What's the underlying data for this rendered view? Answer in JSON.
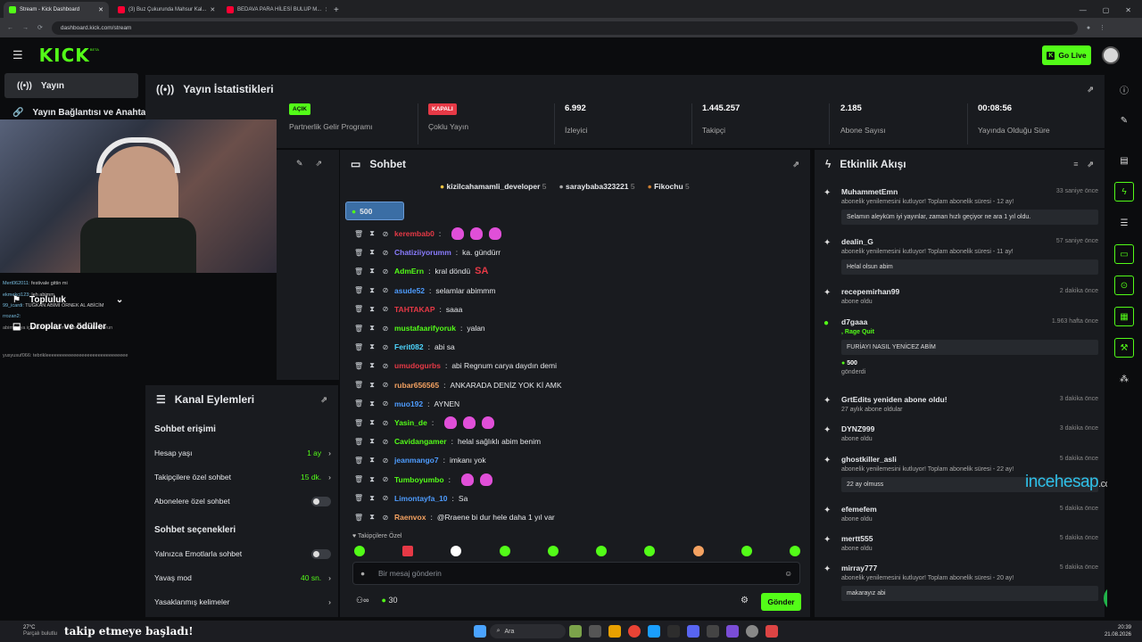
{
  "browser": {
    "tabs": [
      "Stream - Kick Dashboard",
      "(3) Buz Çukurunda Mahsur Kal...",
      "BEDAVA PARA HİLESİ BULUP M..."
    ],
    "new_tab": "+",
    "url": "dashboard.kick.com/stream"
  },
  "header": {
    "logo": "KICK",
    "logo_beta": "BETA",
    "go_live": "Go Live"
  },
  "nav": {
    "items": [
      "Yayın",
      "Yayın Bağlantısı ve Anahtarı",
      "Topluluk",
      "Droplar ve ödüller"
    ]
  },
  "stats": {
    "title": "Yayın İstatistikleri",
    "cells": [
      {
        "badge": "AÇIK",
        "badge_color": "#53fc18",
        "label": "Partnerlik Gelir Programı"
      },
      {
        "badge": "KAPALI",
        "badge_color": "#e63946",
        "label": "Çoklu Yayın"
      },
      {
        "value": "6.992",
        "label": "İzleyici"
      },
      {
        "value": "1.445.257",
        "label": "Takipçi"
      },
      {
        "value": "2.185",
        "label": "Abone Sayısı"
      },
      {
        "value": "00:08:56",
        "label": "Yayında Olduğu Süre"
      }
    ]
  },
  "video": {
    "overlay": [
      {
        "user": "Mert062011:",
        "msg": "festivale gittin mi"
      },
      {
        "user": "ekmekci123:",
        "msg": "leh abimm"
      },
      {
        "user": "99_icardi:",
        "msg": "TUĞKAN ABİMİ ÖRNEK AL ABİCİM"
      },
      {
        "user": "rrozan2:",
        "msg": ""
      },
      {
        "user": "",
        "msg": "abim baya içiyorun bırakçam diyorun bırakmıyorun"
      },
      {
        "user": "yusyusuf066:",
        "msg": "tebrikleeeeeeeeeeeeeeeeeeeeeeeeeeeeee"
      }
    ],
    "label_overlay": "takip etmeye başladı!"
  },
  "chat": {
    "title": "Sohbet",
    "pinned": [
      {
        "name": "kizilcahamamli_developer",
        "n": "5"
      },
      {
        "name": "saraybaba323221",
        "n": "5"
      },
      {
        "name": "Fikochu",
        "n": "5"
      }
    ],
    "kick_amount": "500",
    "messages": [
      {
        "user": "kerembab0",
        "color": "#e63946",
        "msg": "",
        "emotes": 3
      },
      {
        "user": "Chatiziiyorumm",
        "color": "#8a7cff",
        "msg": "ka. gündürr",
        "emotes": 0
      },
      {
        "user": "AdmErn",
        "color": "#53fc18",
        "msg": "kral döndü",
        "emotes": 0,
        "tag": "SA"
      },
      {
        "user": "asude52",
        "color": "#4e9cff",
        "msg": "selamlar abimmm",
        "emotes": 0
      },
      {
        "user": "TAHTAKAP",
        "color": "#e63946",
        "msg": "saaa",
        "emotes": 0
      },
      {
        "user": "mustafaarifyoruk",
        "color": "#53fc18",
        "msg": "yalan",
        "emotes": 0
      },
      {
        "user": "Ferit082",
        "color": "#4ed6ff",
        "msg": "abi sa",
        "emotes": 0
      },
      {
        "user": "umudogurbs",
        "color": "#e63946",
        "msg": "abi Regnum carya daydın demi",
        "emotes": 0
      },
      {
        "user": "rubar656565",
        "color": "#f4a261",
        "msg": "ANKARADA DENİZ YOK Kİ AMK",
        "emotes": 0
      },
      {
        "user": "muo192",
        "color": "#4e9cff",
        "msg": "AYNEN",
        "emotes": 0
      },
      {
        "user": "Yasin_de",
        "color": "#53fc18",
        "msg": "",
        "emotes": 3
      },
      {
        "user": "Cavidangamer",
        "color": "#53fc18",
        "msg": "helal sağlıklı abim benim",
        "emotes": 0
      },
      {
        "user": "jeanmango7",
        "color": "#4e9cff",
        "msg": "imkanı yok",
        "emotes": 0
      },
      {
        "user": "Tumboyumbo",
        "color": "#53fc18",
        "msg": "",
        "emotes": 2
      },
      {
        "user": "Limontayfa_10",
        "color": "#4e9cff",
        "msg": "Sa",
        "emotes": 0
      },
      {
        "user": "Raenvox",
        "color": "#f4a261",
        "msg": "@Rraene bi dur hele daha 1 yıl var",
        "emotes": 0
      }
    ],
    "followers_only": "Takipçilere Özel",
    "placeholder": "Bir mesaj gönderin",
    "points": "30",
    "send": "Gönder"
  },
  "actions": {
    "title": "Kanal Eylemleri",
    "access_title": "Sohbet erişimi",
    "rows": [
      {
        "label": "Hesap yaşı",
        "value": "1 ay"
      },
      {
        "label": "Takipçilere özel sohbet",
        "value": "15 dk."
      },
      {
        "label": "Abonelere özel sohbet",
        "value": ""
      }
    ],
    "options_title": "Sohbet seçenekleri",
    "rows2": [
      {
        "label": "Yalnızca Emotlarla sohbet",
        "value": ""
      },
      {
        "label": "Yavaş mod",
        "value": "40 sn."
      },
      {
        "label": "Yasaklanmış kelimeler",
        "value": ""
      }
    ]
  },
  "activity": {
    "title": "Etkinlik Akışı",
    "items": [
      {
        "name": "MuhammetEmn",
        "time": "33 saniye önce",
        "desc": "abonelik yenilemesini kutluyor! Toplam abonelik süresi - 12 ay!",
        "msg": "Selamın aleyküm iyi yayınlar, zaman hızlı geçiyor ne ara 1 yıl oldu."
      },
      {
        "name": "dealin_G",
        "time": "57 saniye önce",
        "desc": "abonelik yenilemesini kutluyor! Toplam abonelik süresi - 11 ay!",
        "msg": "Helal olsun abim"
      },
      {
        "name": "recepemirhan99",
        "time": "2 dakika önce",
        "desc": "abone oldu",
        "msg": ""
      },
      {
        "name": "d7gaaa",
        "time": "1.963 hafta önce",
        "desc": ", Rage Quit",
        "msg": "FURİAYI NASIL YENİCEZ ABİM",
        "extra": "500",
        "extra2": "gönderdi"
      },
      {
        "name": "GrtEdits yeniden abone oldu!",
        "time": "3 dakika önce",
        "desc": "27 aylık abone oldular",
        "msg": ""
      },
      {
        "name": "DYNZ999",
        "time": "3 dakika önce",
        "desc": "abone oldu",
        "msg": ""
      },
      {
        "name": "ghostkiller_asli",
        "time": "5 dakika önce",
        "desc": "abonelik yenilemesini kutluyor! Toplam abonelik süresi - 22 ay!",
        "msg": "22 ay olmuss"
      },
      {
        "name": "efemefem",
        "time": "5 dakika önce",
        "desc": "abone oldu",
        "msg": ""
      },
      {
        "name": "mertt555",
        "time": "5 dakika önce",
        "desc": "abone oldu",
        "msg": ""
      },
      {
        "name": "mirray777",
        "time": "5 dakika önce",
        "desc": "abonelik yenilemesini kutluyor! Toplam abonelik süresi - 20 ay!",
        "msg": "makarayız abi"
      }
    ],
    "watermark": "incehesap",
    "watermark2": ".com"
  },
  "taskbar": {
    "weather": "27°C",
    "weather_sub": "Parçalı bulutlu",
    "search": "Ara",
    "time": "20:39",
    "date": "21.08.2026"
  }
}
